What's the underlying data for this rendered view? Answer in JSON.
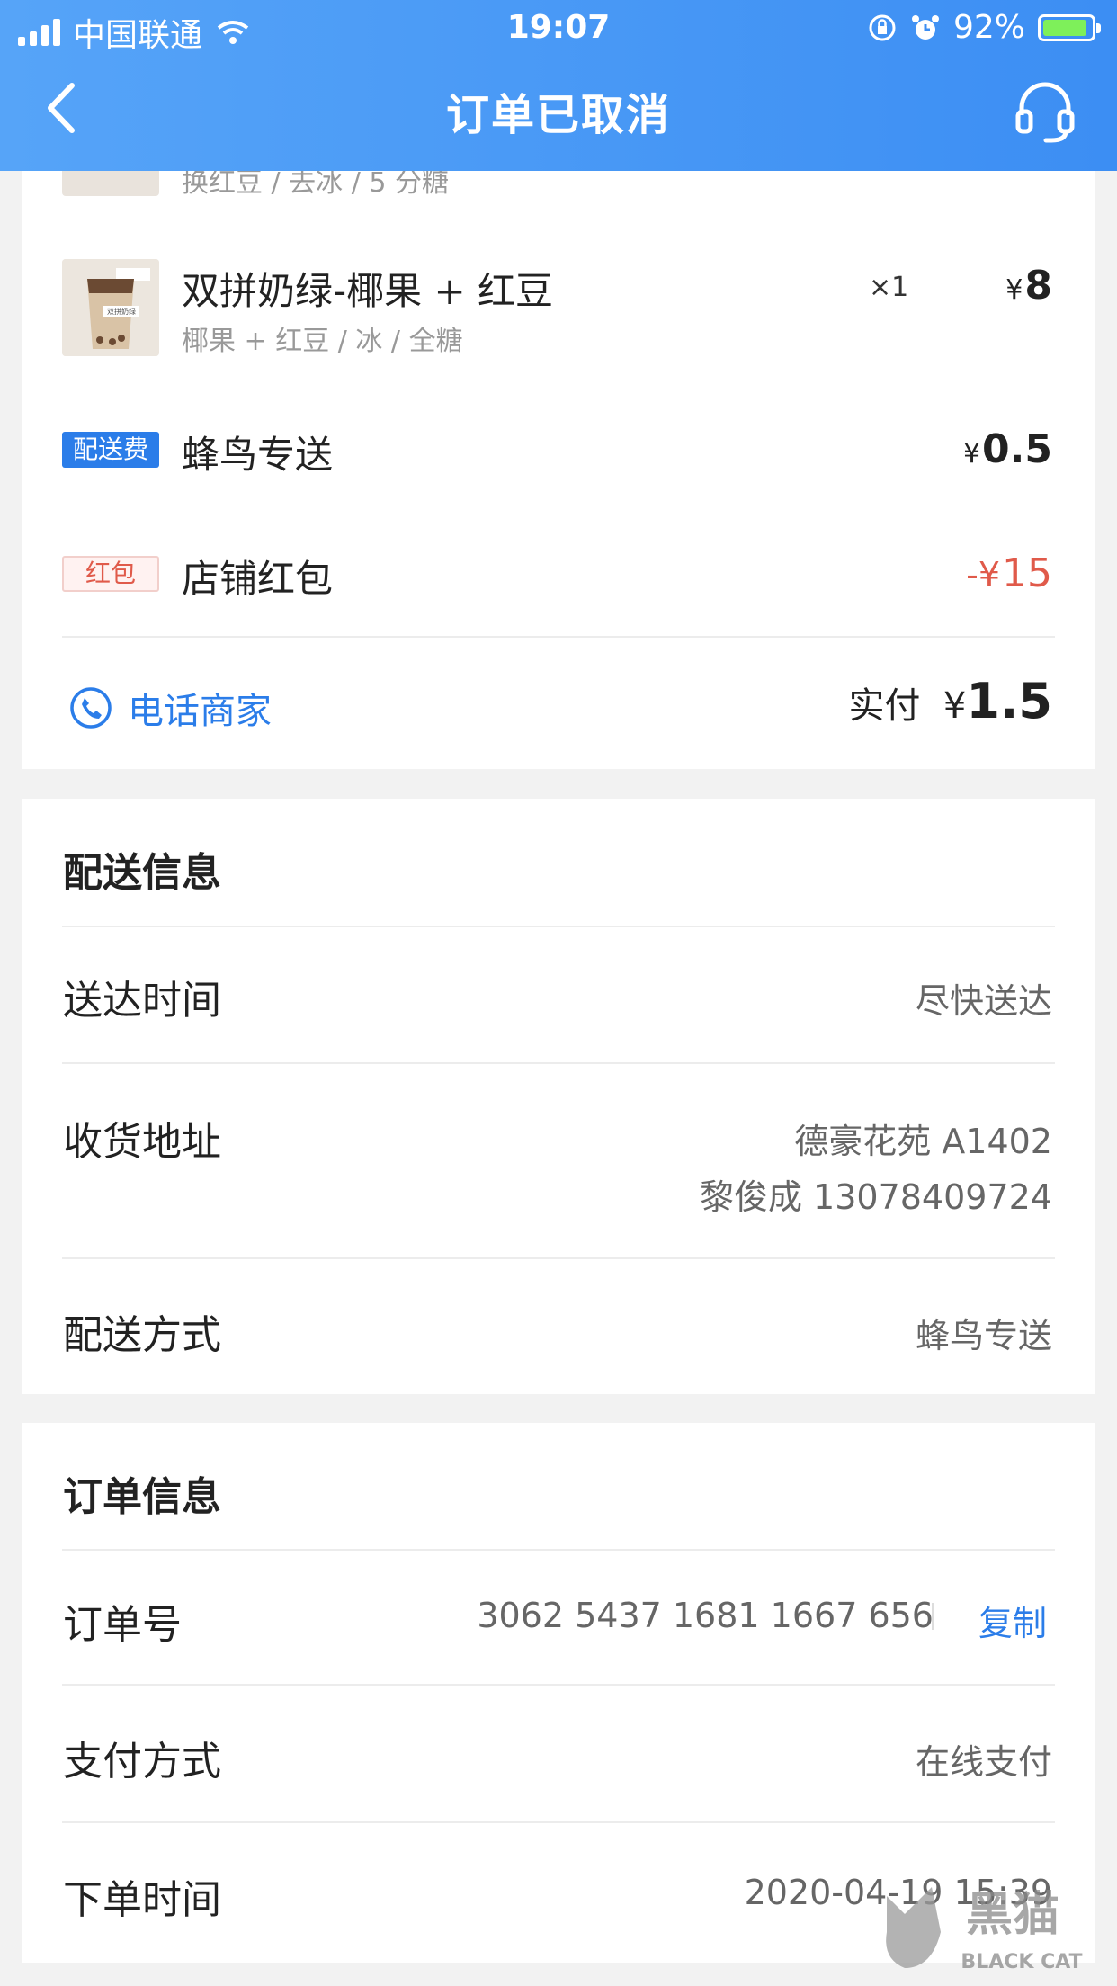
{
  "status_bar": {
    "carrier": "中国联通",
    "time": "19:07",
    "battery": "92%"
  },
  "header": {
    "title": "订单已取消"
  },
  "items": [
    {
      "name": "",
      "spec": "换红豆 / 去冰 / 5 分糖"
    },
    {
      "name": "双拼奶绿-椰果 + 红豆",
      "spec": "椰果 + 红豆 / 冰 / 全糖",
      "qty": "×1",
      "currency": "¥",
      "price": "8",
      "thumb_label": "双拼奶绿"
    }
  ],
  "fees": [
    {
      "tag": "配送费",
      "name": "蜂鸟专送",
      "currency": "¥",
      "amount": "0.5"
    },
    {
      "tag": "红包",
      "name": "店铺红包",
      "currency": "-¥",
      "amount": "15",
      "color": "#e05a4a"
    }
  ],
  "footer": {
    "call_label": "电话商家",
    "paid_label": "实付",
    "currency": "¥",
    "paid_amount": "1.5"
  },
  "delivery": {
    "title": "配送信息",
    "rows": [
      {
        "label": "送达时间",
        "value": "尽快送达"
      },
      {
        "label": "收货地址",
        "value": "德豪花苑 A1402",
        "value2": "黎俊成  13078409724"
      },
      {
        "label": "配送方式",
        "value": "蜂鸟专送"
      }
    ]
  },
  "order": {
    "title": "订单信息",
    "rows": [
      {
        "label": "订单号",
        "value": "3062 5437 1681 1667 656",
        "action": "复制"
      },
      {
        "label": "支付方式",
        "value": "在线支付"
      },
      {
        "label": "下单时间",
        "value": "2020-04-19 15:39"
      }
    ]
  },
  "watermark": {
    "text": "黑猫",
    "sub": "BLACK CAT"
  },
  "colors": {
    "header": "#3c8ef3",
    "accent": "#2b7de9",
    "discount": "#e05a4a"
  }
}
